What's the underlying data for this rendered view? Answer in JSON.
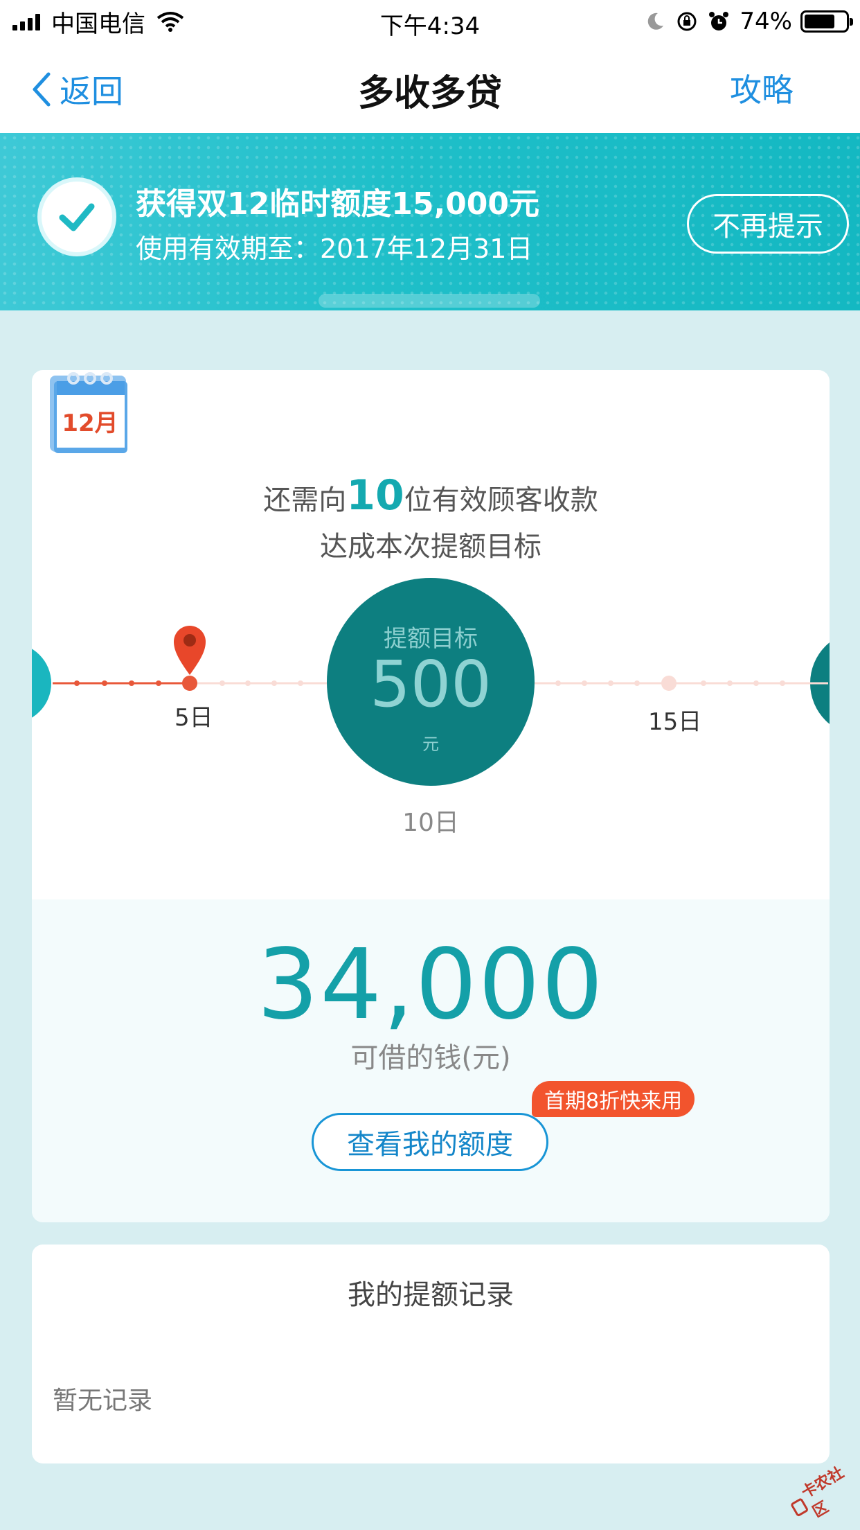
{
  "status_bar": {
    "carrier": "中国电信",
    "time": "下午4:34",
    "battery_percent": "74%",
    "battery_level": 0.74
  },
  "nav": {
    "back_label": "返回",
    "title": "多收多贷",
    "right_label": "攻略"
  },
  "banner": {
    "title": "获得双12临时额度15,000元",
    "subtitle": "使用有效期至：2017年12月31日",
    "dismiss_label": "不再提示"
  },
  "calendar": {
    "month_label": "12月"
  },
  "progress": {
    "need_prefix": "还需向",
    "need_count": "10",
    "need_suffix": "位有效顾客收款",
    "line2": "达成本次提额目标",
    "goal_label": "提额目标",
    "goal_value": "500",
    "goal_unit": "元",
    "milestone_left": "5日",
    "milestone_center": "10日",
    "milestone_right": "15日"
  },
  "borrow": {
    "amount": "34,000",
    "label": "可借的钱(元)",
    "promo": "首期8折快来用",
    "button_label": "查看我的额度"
  },
  "records": {
    "title": "我的提额记录",
    "empty_text": "暂无记录"
  },
  "watermark": {
    "text": "卡农社区"
  },
  "colors": {
    "accent_blue": "#1f8fe0",
    "teal": "#14a9b0",
    "goal_teal": "#0d7f80",
    "promo_red": "#f2542d"
  }
}
